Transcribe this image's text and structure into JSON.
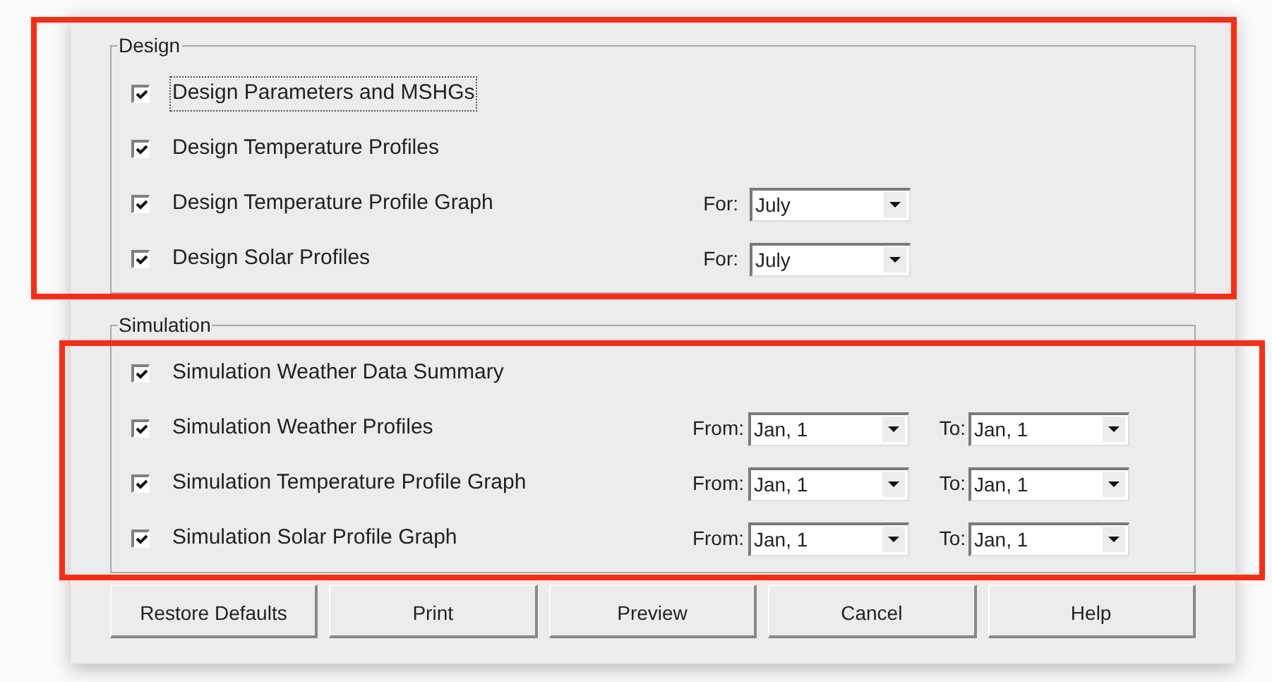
{
  "groups": [
    {
      "title": "Design",
      "items": [
        {
          "kind": "plain",
          "label": "Design Parameters and MSHGs",
          "checked": true,
          "focused": true
        },
        {
          "kind": "plain",
          "label": "Design Temperature Profiles",
          "checked": true,
          "focused": false
        },
        {
          "kind": "month",
          "label": "Design Temperature Profile Graph",
          "checked": true,
          "focused": false,
          "for_label": "For:",
          "month": "July"
        },
        {
          "kind": "month",
          "label": "Design Solar Profiles",
          "checked": true,
          "focused": false,
          "for_label": "For:",
          "month": "July"
        }
      ]
    },
    {
      "title": "Simulation",
      "items": [
        {
          "kind": "plain",
          "label": "Simulation Weather Data Summary",
          "checked": true,
          "focused": false
        },
        {
          "kind": "range",
          "label": "Simulation Weather Profiles",
          "checked": true,
          "focused": false,
          "from_label": "From:",
          "from": "Jan, 1",
          "to_label": "To:",
          "to": "Jan, 1"
        },
        {
          "kind": "range",
          "label": "Simulation Temperature Profile Graph",
          "checked": true,
          "focused": false,
          "from_label": "From:",
          "from": "Jan, 1",
          "to_label": "To:",
          "to": "Jan, 1"
        },
        {
          "kind": "range",
          "label": "Simulation Solar Profile Graph",
          "checked": true,
          "focused": false,
          "from_label": "From:",
          "from": "Jan, 1",
          "to_label": "To:",
          "to": "Jan, 1"
        }
      ]
    }
  ],
  "buttons": [
    "Restore Defaults",
    "Print",
    "Preview",
    "Cancel",
    "Help"
  ],
  "annotation_boxes": [
    {
      "color": "#ff2a12"
    },
    {
      "color": "#ff2a12"
    }
  ]
}
